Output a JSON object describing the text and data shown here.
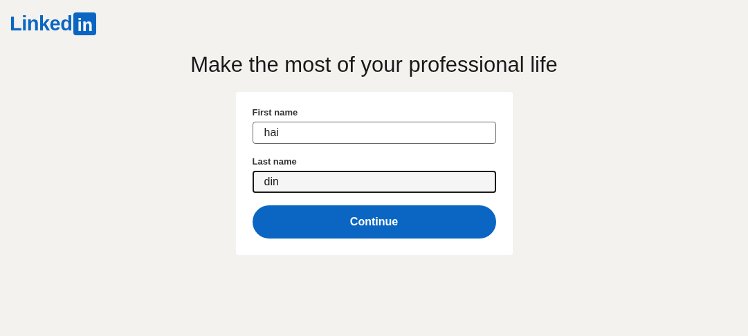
{
  "logo": {
    "text": "Linked",
    "badge": "in"
  },
  "title": "Make the most of your professional life",
  "form": {
    "fields": [
      {
        "label": "First name",
        "value": "hai",
        "focused": false
      },
      {
        "label": "Last name",
        "value": "din",
        "focused": true
      }
    ],
    "button": "Continue"
  }
}
